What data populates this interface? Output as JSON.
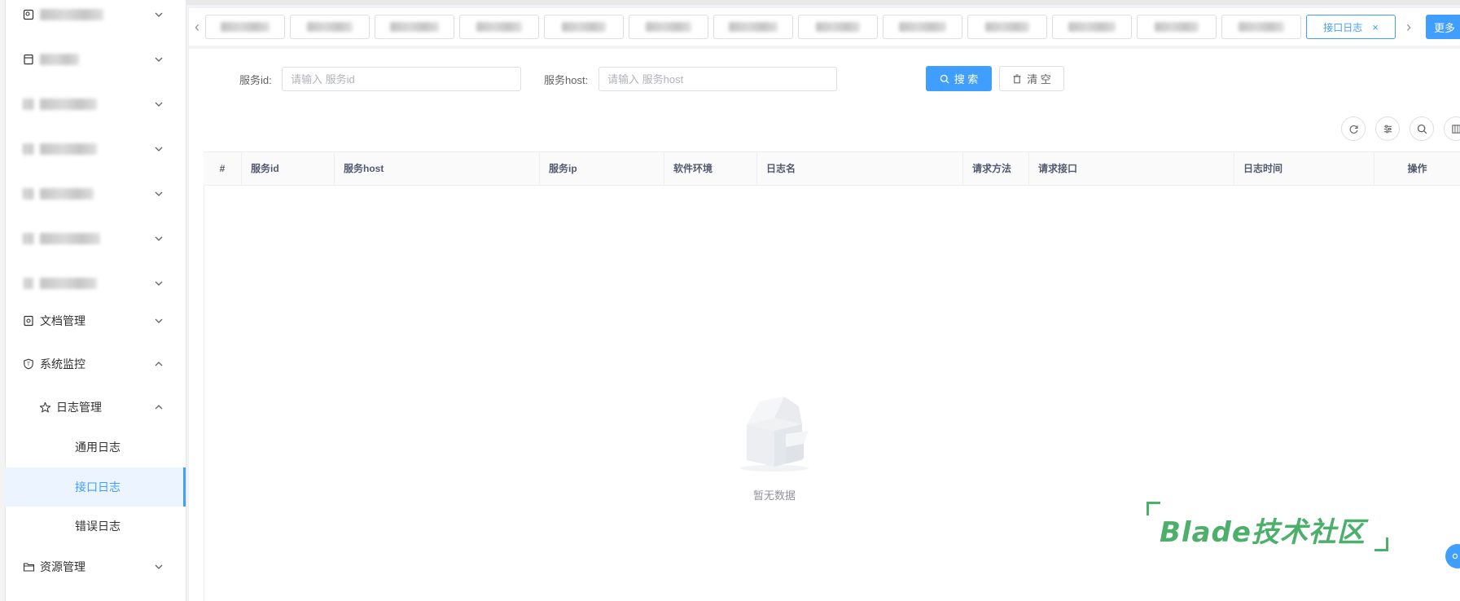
{
  "sidebar": {
    "items": [
      {
        "label": "",
        "blurred": true,
        "chevron": "down"
      },
      {
        "label": "",
        "blurred": true,
        "chevron": "down"
      },
      {
        "label": "",
        "blurred": true,
        "chevron": "down"
      },
      {
        "label": "",
        "blurred": true,
        "chevron": "down"
      },
      {
        "label": "",
        "blurred": true,
        "chevron": "down"
      },
      {
        "label": "",
        "blurred": true,
        "chevron": "down"
      },
      {
        "label": "",
        "blurred": true,
        "chevron": "down"
      },
      {
        "label": "文档管理",
        "chevron": "down"
      },
      {
        "label": "系统监控",
        "chevron": "up"
      },
      {
        "label": "日志管理",
        "chevron": "up"
      },
      {
        "label": "通用日志"
      },
      {
        "label": "接口日志",
        "active": true
      },
      {
        "label": "错误日志"
      },
      {
        "label": "资源管理",
        "chevron": "down"
      }
    ]
  },
  "tabs": {
    "items": [
      {
        "label": "",
        "blurred": true
      },
      {
        "label": "",
        "blurred": true
      },
      {
        "label": "",
        "blurred": true
      },
      {
        "label": "",
        "blurred": true
      },
      {
        "label": "",
        "blurred": true
      },
      {
        "label": "",
        "blurred": true
      },
      {
        "label": "",
        "blurred": true
      },
      {
        "label": "",
        "blurred": true
      },
      {
        "label": "",
        "blurred": true
      },
      {
        "label": "",
        "blurred": true
      },
      {
        "label": "",
        "blurred": true
      },
      {
        "label": "",
        "blurred": true
      },
      {
        "label": "",
        "blurred": true
      },
      {
        "label": "接口日志",
        "active": true,
        "close": "×"
      }
    ],
    "more_label": "更多"
  },
  "search": {
    "service_id_label": "服务id:",
    "service_id_placeholder": "请输入 服务id",
    "service_id_value": "",
    "service_host_label": "服务host:",
    "service_host_placeholder": "请输入 服务host",
    "service_host_value": "",
    "search_button": "搜 索",
    "clear_button": "清 空"
  },
  "table": {
    "columns": [
      "#",
      "服务id",
      "服务host",
      "服务ip",
      "软件环境",
      "日志名",
      "请求方法",
      "请求接口",
      "日志时间",
      "操作"
    ],
    "rows": [],
    "empty_text": "暂无数据"
  },
  "watermark": {
    "text": "Blade技术社区"
  },
  "colors": {
    "primary": "#409eff",
    "watermark": "#4caf6a",
    "active_bg": "#ecf5ff"
  }
}
